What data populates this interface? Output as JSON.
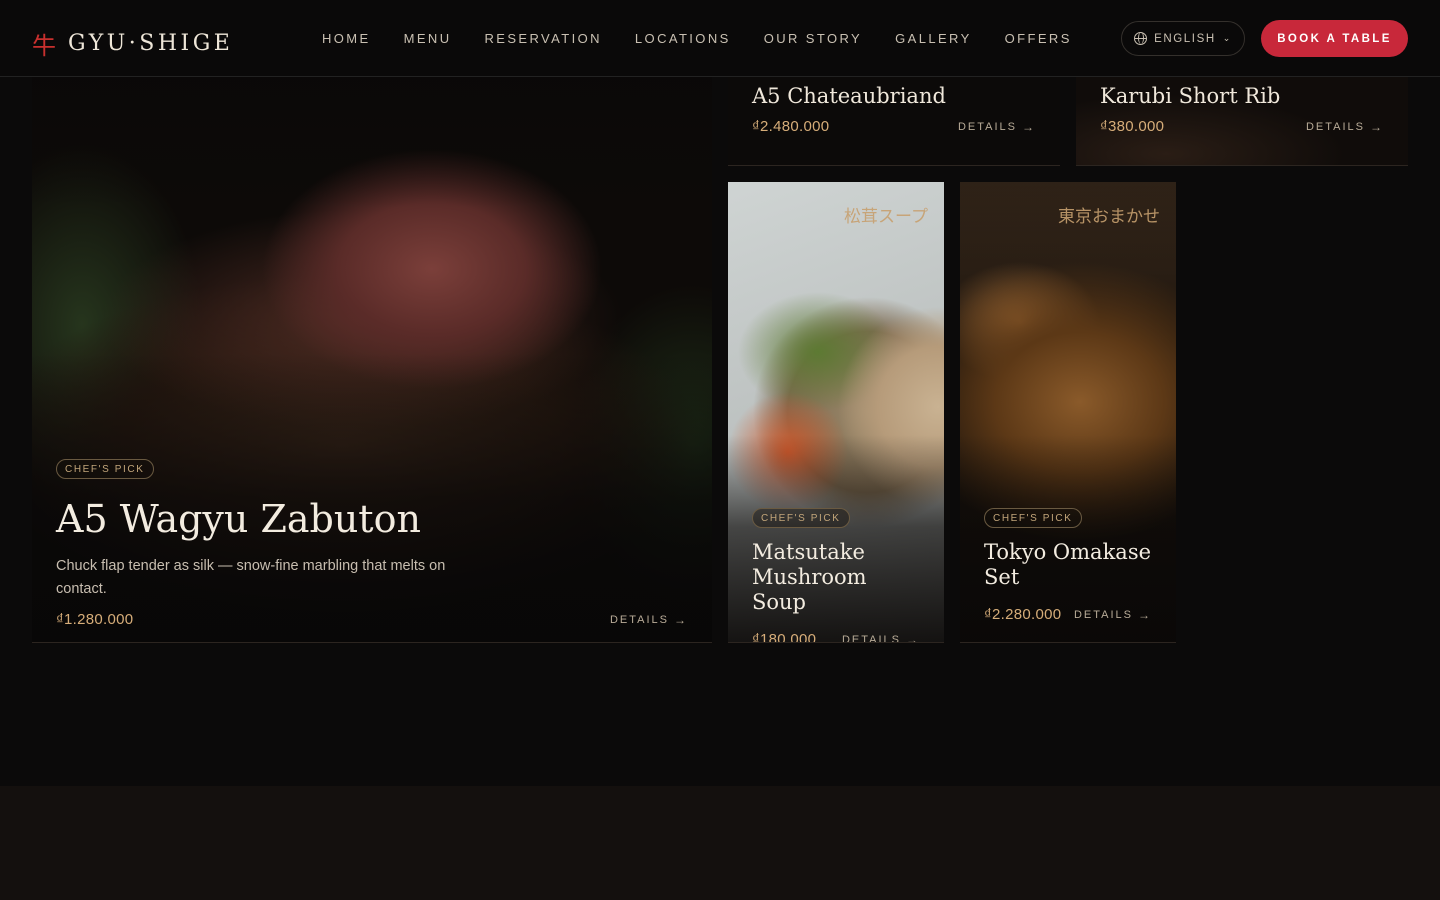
{
  "brand": {
    "mark": "牛",
    "name": "GYU·SHIGE"
  },
  "nav": {
    "items": [
      "HOME",
      "MENU",
      "RESERVATION",
      "LOCATIONS",
      "OUR STORY",
      "GALLERY",
      "OFFERS"
    ]
  },
  "language": {
    "label": "ENGLISH",
    "icon": "globe-icon"
  },
  "cta": {
    "label": "BOOK A TABLE"
  },
  "cards": {
    "featured": {
      "badge": "CHEF'S PICK",
      "title": "A5 Wagyu Zabuton",
      "description": "Chuck flap tender as silk — snow-fine marbling that melts on contact.",
      "price": "₫1.280.000",
      "details": "DETAILS"
    },
    "chateaubriand": {
      "title": "A5 Chateaubriand",
      "price": "₫2.480.000",
      "details": "DETAILS"
    },
    "karubi": {
      "title": "Karubi Short Rib",
      "price": "₫380.000",
      "details": "DETAILS"
    },
    "soup": {
      "jp_label": "松茸スープ",
      "badge": "CHEF'S PICK",
      "title": "Matsutake Mushroom Soup",
      "price": "₫180.000",
      "details": "DETAILS"
    },
    "omakase": {
      "jp_label": "東京おまかせ",
      "badge": "CHEF'S PICK",
      "title": "Tokyo Omakase Set",
      "price": "₫2.280.000",
      "details": "DETAILS"
    }
  },
  "colors": {
    "accent_red": "#c8283a",
    "price_gold": "#d6ad79",
    "background": "#0b0a0a"
  }
}
